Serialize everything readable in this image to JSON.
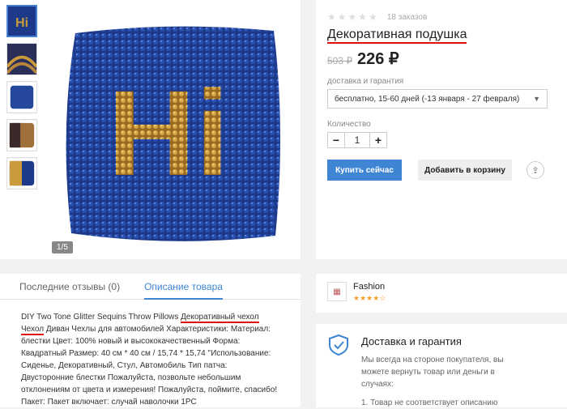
{
  "gallery": {
    "thumbnails": [
      {
        "label": "blue-hi",
        "active": true
      },
      {
        "label": "gold-stripes",
        "active": false
      },
      {
        "label": "blue-plain",
        "active": false
      },
      {
        "label": "copper",
        "active": false
      },
      {
        "label": "gold-blue",
        "active": false
      }
    ],
    "counter": "1/5",
    "main_image_text": "Hi"
  },
  "product": {
    "orders": "18 заказов",
    "rating_filled": 0,
    "rating_max": 5,
    "title": "Декоративная подушка",
    "old_price": "503 ₽",
    "price": "226 ₽",
    "delivery_label": "доставка и гарантия",
    "delivery_option": "бесплатно, 15-60 дней (-13 января - 27 февраля)",
    "quantity_label": "Количество",
    "quantity": "1",
    "minus": "−",
    "plus": "+",
    "buy_label": "Купить сейчас",
    "cart_label": "Добавить в корзину"
  },
  "tabs": {
    "reviews": "Последние отзывы (0)",
    "description": "Описание товара"
  },
  "description": {
    "prefix": "DIY Two Tone Glitter Sequins Throw Pillows ",
    "highlight": "Декоративный чехол Чехол",
    "body": "Диван Чехлы для автомобилей Характеристики: Материал: блестки Цвет: 100% новый и высококачественный Форма: Квадратный Размер: 40 см * 40 см / 15,74 * 15,74 \"Использование: Сиденье, Декоративный, Стул, Автомобиль Тип патча: Двусторонние блестки Пожалуйста, позвольте небольшим отклонениям от цвета и измерения! Пожалуйста, поймите, спасибо! Пакет: Пакет включает: случай наволочки 1PC"
  },
  "store": {
    "name": "Fashion",
    "rating_stars": 4.5
  },
  "delivery": {
    "title": "Доставка и гарантия",
    "text": "Мы всегда на стороне покупателя, вы можете вернуть товар или деньги в случаях:",
    "item": "1. Товар не соответствует описанию"
  },
  "colors": {
    "accent": "#3e86d4",
    "underline": "#dd1111",
    "sequin_blue": "#1d3a8a",
    "sequin_gold": "#c89a3a"
  }
}
